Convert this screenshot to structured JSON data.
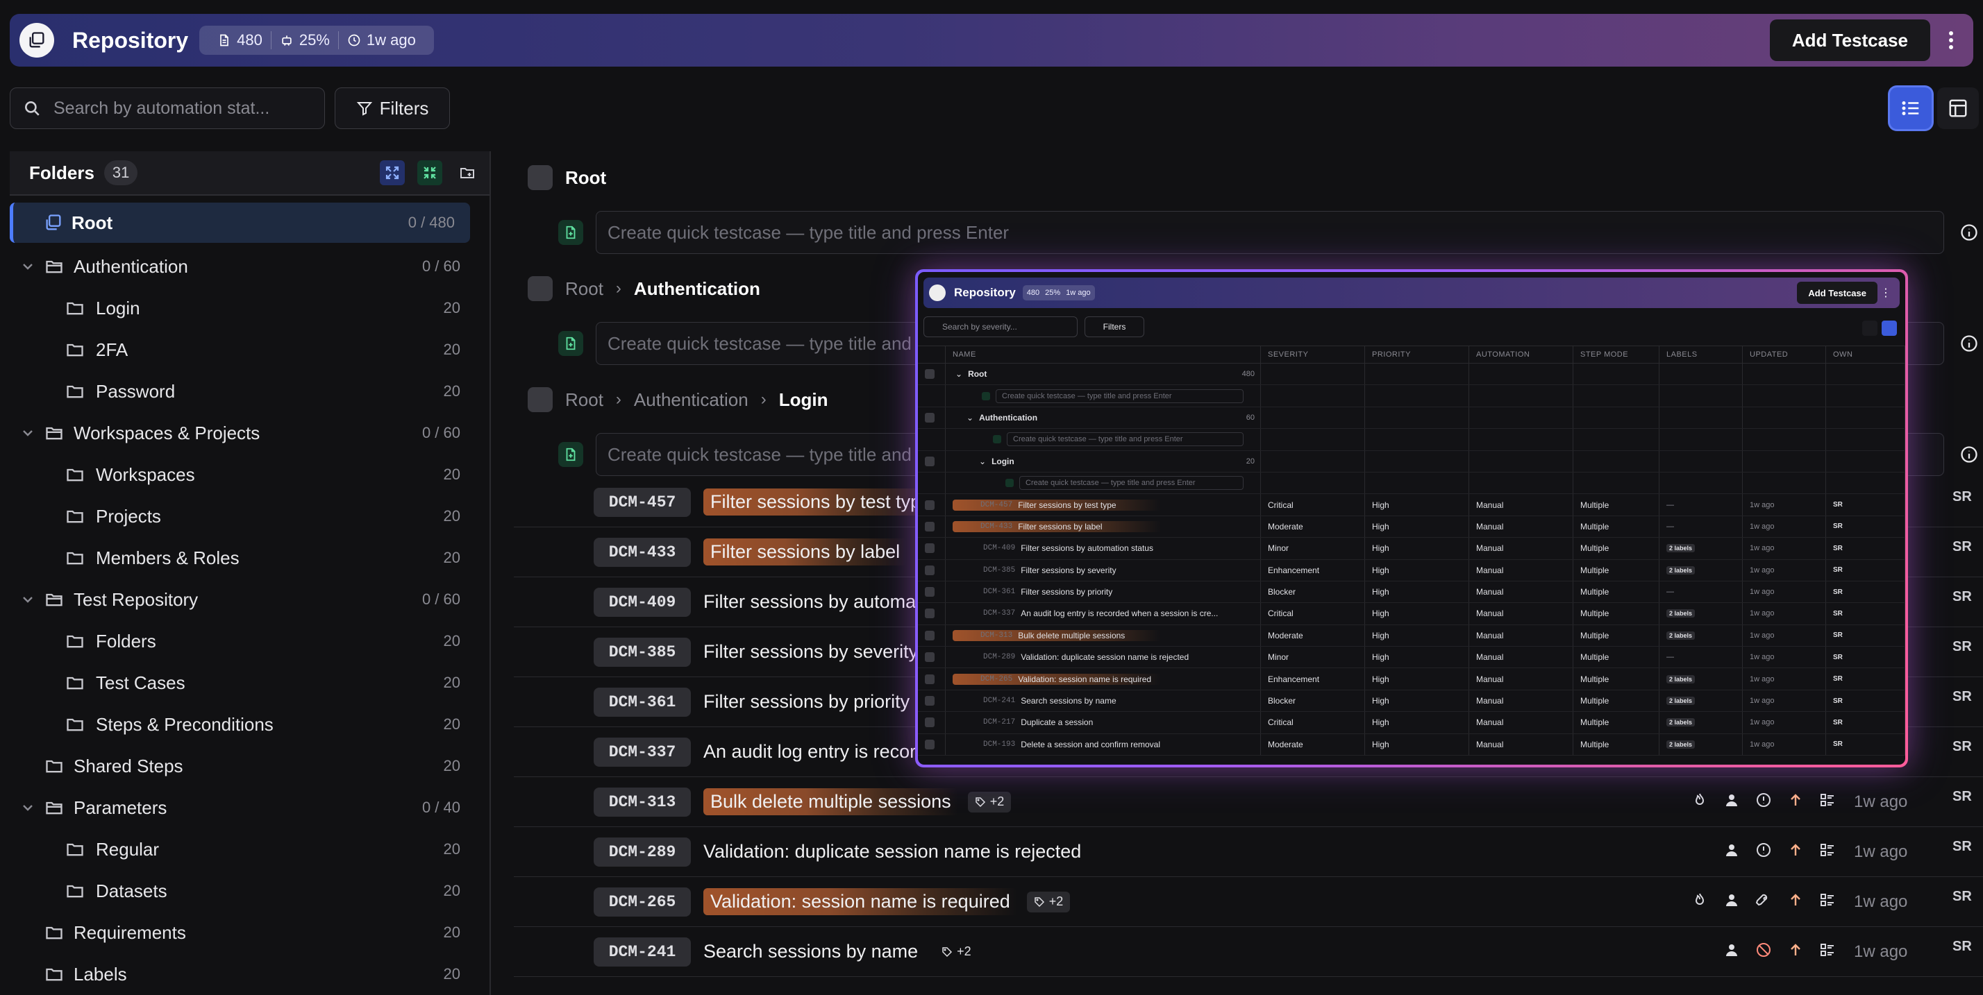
{
  "header": {
    "title": "Repository",
    "stats": {
      "cases": "480",
      "automation": "25%",
      "updated": "1w ago"
    },
    "add_button": "Add Testcase"
  },
  "toolbar": {
    "search_placeholder": "Search by automation stat...",
    "filters_label": "Filters"
  },
  "sidebar": {
    "title": "Folders",
    "count": "31",
    "root": {
      "label": "Root",
      "count": "0 / 480"
    },
    "items": [
      {
        "label": "Authentication",
        "count": "0 / 60",
        "level": 0,
        "expandable": true
      },
      {
        "label": "Login",
        "count": "20",
        "level": 1,
        "expandable": false
      },
      {
        "label": "2FA",
        "count": "20",
        "level": 1,
        "expandable": false
      },
      {
        "label": "Password",
        "count": "20",
        "level": 1,
        "expandable": false
      },
      {
        "label": "Workspaces & Projects",
        "count": "0 / 60",
        "level": 0,
        "expandable": true
      },
      {
        "label": "Workspaces",
        "count": "20",
        "level": 1,
        "expandable": false
      },
      {
        "label": "Projects",
        "count": "20",
        "level": 1,
        "expandable": false
      },
      {
        "label": "Members & Roles",
        "count": "20",
        "level": 1,
        "expandable": false
      },
      {
        "label": "Test Repository",
        "count": "0 / 60",
        "level": 0,
        "expandable": true
      },
      {
        "label": "Folders",
        "count": "20",
        "level": 1,
        "expandable": false
      },
      {
        "label": "Test Cases",
        "count": "20",
        "level": 1,
        "expandable": false
      },
      {
        "label": "Steps & Preconditions",
        "count": "20",
        "level": 1,
        "expandable": false
      },
      {
        "label": "Shared Steps",
        "count": "20",
        "level": 0,
        "expandable": false
      },
      {
        "label": "Parameters",
        "count": "0 / 40",
        "level": 0,
        "expandable": true
      },
      {
        "label": "Regular",
        "count": "20",
        "level": 1,
        "expandable": false
      },
      {
        "label": "Datasets",
        "count": "20",
        "level": 1,
        "expandable": false
      },
      {
        "label": "Requirements",
        "count": "20",
        "level": 0,
        "expandable": false
      },
      {
        "label": "Labels",
        "count": "20",
        "level": 0,
        "expandable": false
      }
    ]
  },
  "main": {
    "crumbs": {
      "root": "Root",
      "authentication": "Authentication",
      "login": "Login"
    },
    "quick_placeholder": "Create quick testcase — type title and press Enter",
    "testcases": [
      {
        "id": "DCM-457",
        "title": "Filter sessions by test type",
        "highlight": true,
        "tags": "",
        "updated": "",
        "owner": "SR"
      },
      {
        "id": "DCM-433",
        "title": "Filter sessions by label",
        "highlight": true,
        "tags": "",
        "updated": "",
        "owner": "SR"
      },
      {
        "id": "DCM-409",
        "title": "Filter sessions by automat",
        "highlight": false,
        "tags": "",
        "updated": "",
        "owner": "SR"
      },
      {
        "id": "DCM-385",
        "title": "Filter sessions by severity",
        "highlight": false,
        "tags": "",
        "updated": "",
        "owner": "SR"
      },
      {
        "id": "DCM-361",
        "title": "Filter sessions by priority",
        "highlight": false,
        "tags": "",
        "updated": "",
        "owner": "SR"
      },
      {
        "id": "DCM-337",
        "title": "An audit log entry is recor",
        "highlight": false,
        "tags": "",
        "updated": "",
        "owner": "SR"
      },
      {
        "id": "DCM-313",
        "title": "Bulk delete multiple sessions",
        "highlight": true,
        "tags": "+2",
        "updated": "1w ago",
        "owner": "SR"
      },
      {
        "id": "DCM-289",
        "title": "Validation: duplicate session name is rejected",
        "highlight": false,
        "tags": "",
        "updated": "1w ago",
        "owner": "SR"
      },
      {
        "id": "DCM-265",
        "title": "Validation: session name is required",
        "highlight": true,
        "tags": "+2",
        "updated": "1w ago",
        "owner": "SR"
      },
      {
        "id": "DCM-241",
        "title": "Search sessions by name",
        "highlight": false,
        "tags": "+2",
        "updated": "1w ago",
        "owner": "SR"
      }
    ]
  },
  "overlay": {
    "title": "Repository",
    "stats": {
      "cases": "480",
      "automation": "25%",
      "updated": "1w ago"
    },
    "add_button": "Add Testcase",
    "search_placeholder": "Search by severity...",
    "filters_label": "Filters",
    "columns": [
      "NAME",
      "SEVERITY",
      "PRIORITY",
      "AUTOMATION",
      "STEP MODE",
      "LABELS",
      "UPDATED",
      "OWN"
    ],
    "root_label": "Root",
    "root_count": "480",
    "auth_label": "Authentication",
    "auth_count": "60",
    "login_label": "Login",
    "login_count": "20",
    "quick_placeholder": "Create quick testcase — type title and press Enter",
    "rows": [
      {
        "id": "DCM-457",
        "title": "Filter sessions by test type",
        "hl": true,
        "severity": "Critical",
        "priority": "High",
        "automation": "Manual",
        "step_mode": "Multiple",
        "labels": "—",
        "updated": "1w ago",
        "owner": "SR"
      },
      {
        "id": "DCM-433",
        "title": "Filter sessions by label",
        "hl": true,
        "severity": "Moderate",
        "priority": "High",
        "automation": "Manual",
        "step_mode": "Multiple",
        "labels": "—",
        "updated": "1w ago",
        "owner": "SR"
      },
      {
        "id": "DCM-409",
        "title": "Filter sessions by automation status",
        "hl": false,
        "severity": "Minor",
        "priority": "High",
        "automation": "Manual",
        "step_mode": "Multiple",
        "labels": "2 labels",
        "updated": "1w ago",
        "owner": "SR"
      },
      {
        "id": "DCM-385",
        "title": "Filter sessions by severity",
        "hl": false,
        "severity": "Enhancement",
        "priority": "High",
        "automation": "Manual",
        "step_mode": "Multiple",
        "labels": "2 labels",
        "updated": "1w ago",
        "owner": "SR"
      },
      {
        "id": "DCM-361",
        "title": "Filter sessions by priority",
        "hl": false,
        "severity": "Blocker",
        "priority": "High",
        "automation": "Manual",
        "step_mode": "Multiple",
        "labels": "—",
        "updated": "1w ago",
        "owner": "SR"
      },
      {
        "id": "DCM-337",
        "title": "An audit log entry is recorded when a session is cre...",
        "hl": false,
        "severity": "Critical",
        "priority": "High",
        "automation": "Manual",
        "step_mode": "Multiple",
        "labels": "2 labels",
        "updated": "1w ago",
        "owner": "SR"
      },
      {
        "id": "DCM-313",
        "title": "Bulk delete multiple sessions",
        "hl": true,
        "severity": "Moderate",
        "priority": "High",
        "automation": "Manual",
        "step_mode": "Multiple",
        "labels": "2 labels",
        "updated": "1w ago",
        "owner": "SR"
      },
      {
        "id": "DCM-289",
        "title": "Validation: duplicate session name is rejected",
        "hl": false,
        "severity": "Minor",
        "priority": "High",
        "automation": "Manual",
        "step_mode": "Multiple",
        "labels": "—",
        "updated": "1w ago",
        "owner": "SR"
      },
      {
        "id": "DCM-265",
        "title": "Validation: session name is required",
        "hl": true,
        "severity": "Enhancement",
        "priority": "High",
        "automation": "Manual",
        "step_mode": "Multiple",
        "labels": "2 labels",
        "updated": "1w ago",
        "owner": "SR"
      },
      {
        "id": "DCM-241",
        "title": "Search sessions by name",
        "hl": false,
        "severity": "Blocker",
        "priority": "High",
        "automation": "Manual",
        "step_mode": "Multiple",
        "labels": "2 labels",
        "updated": "1w ago",
        "owner": "SR"
      },
      {
        "id": "DCM-217",
        "title": "Duplicate a session",
        "hl": false,
        "severity": "Critical",
        "priority": "High",
        "automation": "Manual",
        "step_mode": "Multiple",
        "labels": "2 labels",
        "updated": "1w ago",
        "owner": "SR"
      },
      {
        "id": "DCM-193",
        "title": "Delete a session and confirm removal",
        "hl": false,
        "severity": "Moderate",
        "priority": "High",
        "automation": "Manual",
        "step_mode": "Multiple",
        "labels": "2 labels",
        "updated": "1w ago",
        "owner": "SR"
      }
    ]
  },
  "colors": {
    "accent": "#3b5bdb",
    "highlight": "#a0532b",
    "background": "#111113",
    "quick_icon": "#143527"
  },
  "icons": [
    "repository-logo-icon",
    "document-icon",
    "robot-icon",
    "clock-icon",
    "kebab-icon",
    "search-icon",
    "filter-icon",
    "list-view-icon",
    "grid-view-icon",
    "expand-all-icon",
    "collapse-all-icon",
    "new-folder-icon",
    "folder-icon",
    "chevron-down-icon",
    "add-file-icon",
    "info-icon",
    "tag-icon",
    "flame-icon",
    "user-icon",
    "priority-up-icon",
    "steps-icon",
    "blocker-icon",
    "rocket-icon"
  ]
}
